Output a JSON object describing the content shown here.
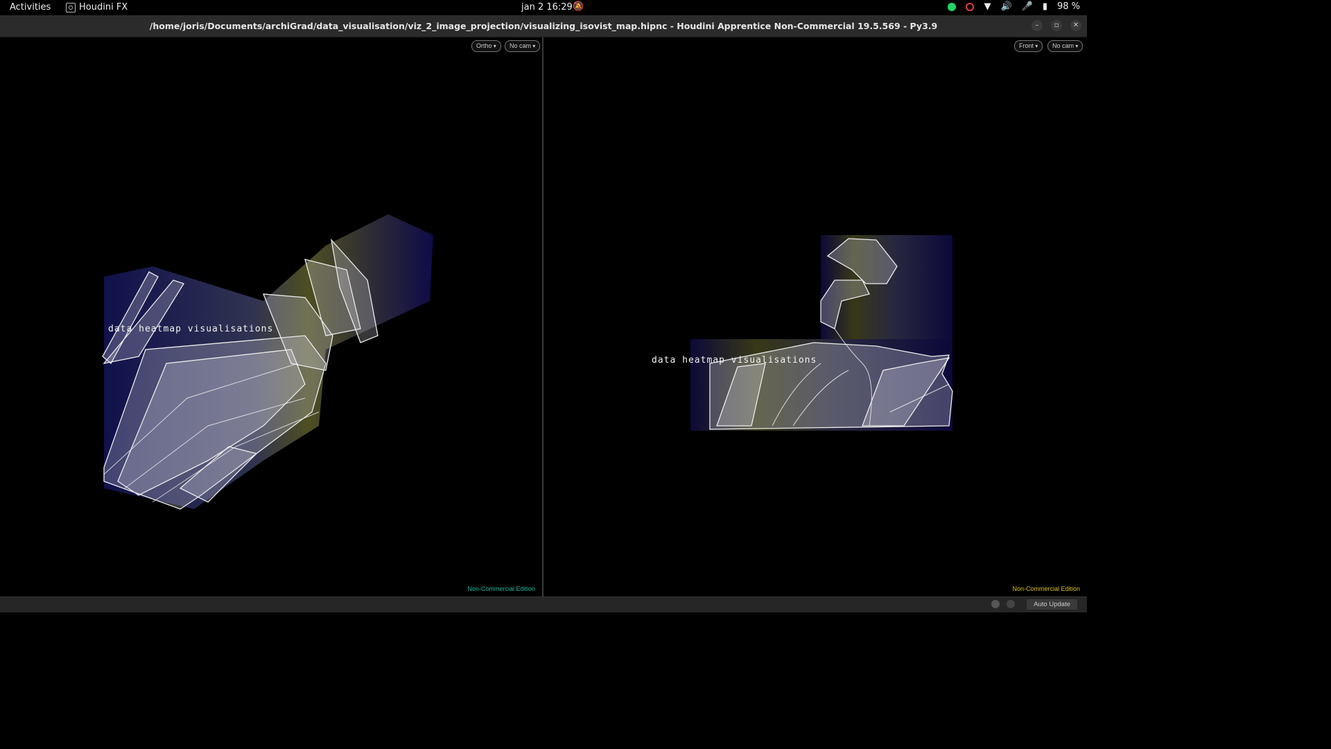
{
  "topbar": {
    "activities": "Activities",
    "app_name": "Houdini FX",
    "clock": "jan 2  16:29",
    "battery": "98 %"
  },
  "window": {
    "title": "/home/joris/Documents/archiGrad/data_visualisation/viz_2_image_projection/visualizing_isovist_map.hipnc - Houdini Apprentice Non-Commercial 19.5.569 - Py3.9",
    "minimize": "–",
    "maximize": "▫",
    "close": "✕"
  },
  "left_viewport": {
    "view_menu": "Ortho",
    "cam_menu": "No cam",
    "overlay_text": "data heatmap visualisations",
    "edition": "Non-Commercial Edition",
    "edition_color": "#1fb8a0"
  },
  "right_viewport": {
    "view_menu": "Front",
    "cam_menu": "No cam",
    "overlay_text": "data heatmap visualisations",
    "edition": "Non-Commercial Edition",
    "edition_color": "#d8c020"
  },
  "statusbar": {
    "auto_update": "Auto Update"
  },
  "colors": {
    "heat_low": "#2a1fd0",
    "heat_mid": "#8a90e8",
    "heat_high": "#e8e040",
    "wire": "#e8e8e8"
  }
}
